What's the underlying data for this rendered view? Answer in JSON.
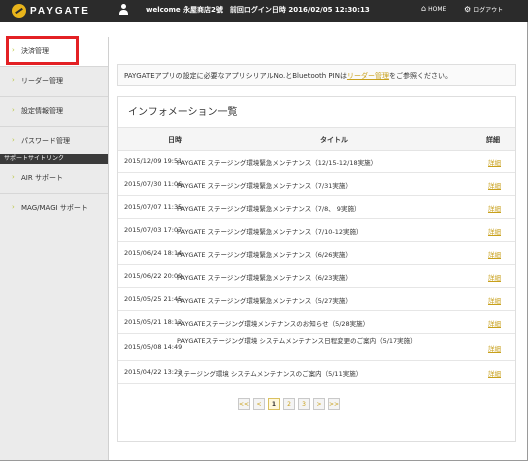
{
  "header": {
    "logo": "PAYGATE",
    "welcome": "welcome 永屋商店2號　前回ログイン日時 2016/02/05 12:30:13",
    "home": "HOME",
    "logout": "ログアウト"
  },
  "sidebar": {
    "items": [
      {
        "label": "決済管理"
      },
      {
        "label": "リーダー管理"
      },
      {
        "label": "設定情報管理"
      },
      {
        "label": "パスワード管理"
      }
    ],
    "section": "サポートサイトリンク",
    "links": [
      {
        "label": "AIR サポート"
      },
      {
        "label": "MAG/MAGI サポート"
      }
    ]
  },
  "notice": {
    "before": "PAYGATEアプリの設定に必要なアプリシリアルNo.とBluetooth PINは",
    "link": "リーダー管理",
    "after": "をご参照ください。"
  },
  "info": {
    "title": "インフォメーション一覧",
    "columns": [
      "日時",
      "タイトル",
      "詳細"
    ],
    "detail_label": "詳細",
    "rows": [
      {
        "date": "2015/12/09 19:51",
        "title": "PAYGATE ステージング環境緊急メンテナンス（12/15-12/18実施）"
      },
      {
        "date": "2015/07/30 11:06",
        "title": "PAYGATE ステージング環境緊急メンテナンス（7/31実施）"
      },
      {
        "date": "2015/07/07 11:35",
        "title": "PAYGATE ステージング環境緊急メンテナンス（7/8、 9実施）"
      },
      {
        "date": "2015/07/03 17:07",
        "title": "PAYGATE ステージング環境緊急メンテナンス（7/10-12実施）"
      },
      {
        "date": "2015/06/24 18:14",
        "title": "PAYGATE ステージング環境緊急メンテナンス（6/26実施）"
      },
      {
        "date": "2015/06/22 20:09",
        "title": "PAYGATE ステージング環境緊急メンテナンス（6/23実施）"
      },
      {
        "date": "2015/05/25 21:45",
        "title": "PAYGATE ステージング環境緊急メンテナンス（5/27実施）"
      },
      {
        "date": "2015/05/21 18:12",
        "title": "PAYGATEステージング環境メンテナンスのお知らせ（5/28実施）"
      },
      {
        "date": "2015/05/08 14:49",
        "title": "PAYGATEステージング環境 システムメンテナンス日程変更のご案内（5/17実施）"
      },
      {
        "date": "2015/04/22 13:22",
        "title": "ステージング環境 システムメンテナンスのご案内（5/11実施）"
      }
    ]
  },
  "pager": {
    "first": "<<",
    "prev": "<",
    "pages": [
      "1",
      "2",
      "3"
    ],
    "current": "1",
    "next": ">",
    "last": ">>"
  }
}
